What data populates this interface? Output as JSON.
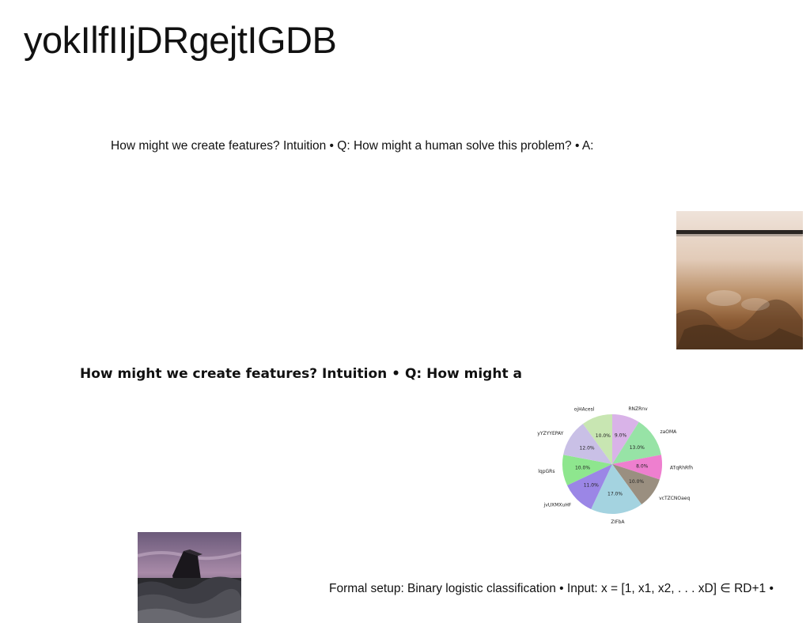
{
  "slide": {
    "title": "yokIlfIIjDRgejtIGDB",
    "text1": "How might we create features? Intuition • Q: How might a human solve this problem? • A:",
    "text2": "How might we create features? Intuition • Q: How might a",
    "text3": "Formal setup: Binary logistic classification • Input: x = [1, x1, x2, . . . xD] ∈ RD+1 •"
  },
  "chart_data": {
    "type": "pie",
    "categories": [
      "RNZRnv",
      "zaOMA",
      "ATqRhRfh",
      "vcTZCNOaeq",
      "ZIFbA",
      "jvUXMXuHF",
      "lqpGRs",
      "yYZYYEPAY",
      "ojHAcesl"
    ],
    "values": [
      9.0,
      13.0,
      8.0,
      10.0,
      17.0,
      11.0,
      10.0,
      12.0,
      10.0
    ],
    "labels": [
      "9.0%",
      "13.0%",
      "8.0%",
      "10.0%",
      "17.0%",
      "11.0%",
      "10.0%",
      "12.0%",
      "10.0%"
    ],
    "colors": [
      "#d9b3e8",
      "#97e3a6",
      "#ee7fcf",
      "#9a8f80",
      "#a4d3e0",
      "#9b86e6",
      "#8ee68e",
      "#c9c0e6",
      "#c8e6b2"
    ],
    "start": "top, clockwise"
  }
}
